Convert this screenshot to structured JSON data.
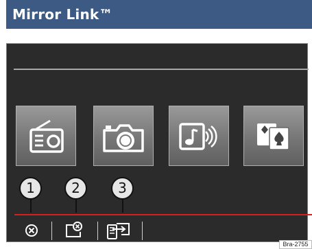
{
  "banner": {
    "title": "Mirror Link™",
    "background": "#3c5a84"
  },
  "screen": {
    "background": "#2b2b2b",
    "apps": [
      {
        "name": "radio",
        "icon": "radio-icon"
      },
      {
        "name": "camera",
        "icon": "camera-icon"
      },
      {
        "name": "music",
        "icon": "music-icon"
      },
      {
        "name": "cards",
        "icon": "playing-cards-icon"
      }
    ],
    "bottom_bar": [
      {
        "icon": "close-icon"
      },
      {
        "icon": "disconnect-device-icon"
      },
      {
        "icon": "switch-device-icon"
      }
    ],
    "accent": "#d81e1e"
  },
  "callouts": [
    "1",
    "2",
    "3"
  ],
  "reference": "Bra-2755"
}
